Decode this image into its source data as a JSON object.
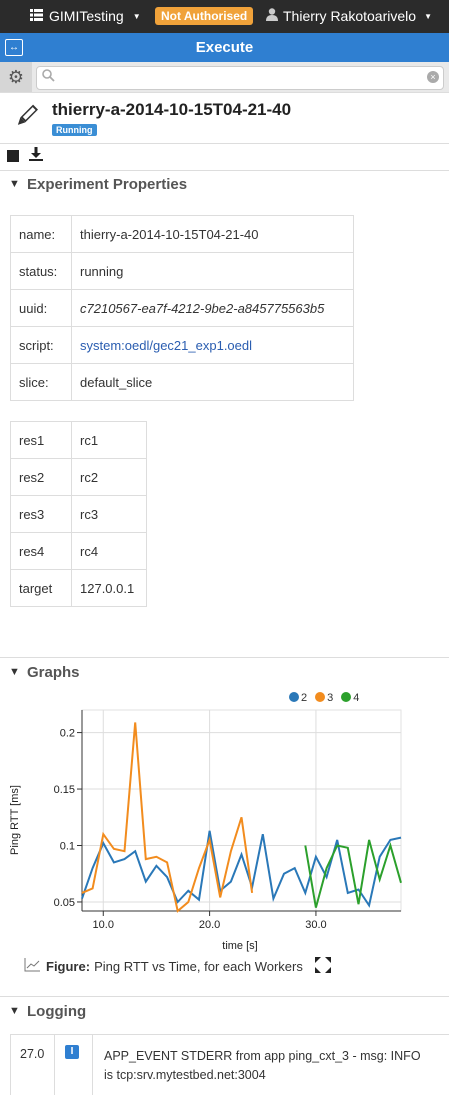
{
  "topbar": {
    "app_name": "GIMITesting",
    "auth_badge": "Not Authorised",
    "user_name": "Thierry Rakotoarivelo"
  },
  "execbar": {
    "title": "Execute"
  },
  "search": {
    "placeholder": ""
  },
  "experiment": {
    "title": "thierry-a-2014-10-15T04-21-40",
    "status_badge": "Running"
  },
  "sections": {
    "properties": "Experiment Properties",
    "graphs": "Graphs",
    "logging": "Logging"
  },
  "properties": [
    {
      "key": "name:",
      "value": "thierry-a-2014-10-15T04-21-40"
    },
    {
      "key": "status:",
      "value": "running"
    },
    {
      "key": "uuid:",
      "value": "c7210567-ea7f-4212-9be2-a845775563b5"
    },
    {
      "key": "script:",
      "value": "system:oedl/gec21_exp1.oedl"
    },
    {
      "key": "slice:",
      "value": "default_slice"
    }
  ],
  "resources": [
    {
      "key": "res1",
      "value": "rc1"
    },
    {
      "key": "res2",
      "value": "rc2"
    },
    {
      "key": "res3",
      "value": "rc3"
    },
    {
      "key": "res4",
      "value": "rc4"
    },
    {
      "key": "target",
      "value": "127.0.0.1"
    }
  ],
  "chart_data": {
    "type": "line",
    "title": "",
    "xlabel": "time [s]",
    "ylabel": "Ping RTT [ms]",
    "xlim": [
      8,
      38
    ],
    "ylim": [
      0.042,
      0.22
    ],
    "x_ticks": [
      10,
      20,
      30
    ],
    "x_tick_labels": [
      "10.0",
      "20.0",
      "30.0"
    ],
    "y_ticks": [
      0.05,
      0.1,
      0.15,
      0.2
    ],
    "y_tick_labels": [
      "0.05",
      "0.1",
      "0.15",
      "0.2"
    ],
    "legend_position": "top-right",
    "series": [
      {
        "name": "2",
        "color": "#2a78b8",
        "x": [
          8,
          9,
          10,
          11,
          12,
          13,
          14,
          15,
          16,
          17,
          18,
          19,
          20,
          21,
          22,
          23,
          24,
          25,
          26,
          27,
          28,
          29,
          30,
          31,
          32,
          33,
          34,
          35,
          36,
          37,
          38
        ],
        "y": [
          0.053,
          0.08,
          0.102,
          0.085,
          0.088,
          0.095,
          0.068,
          0.082,
          0.072,
          0.05,
          0.06,
          0.052,
          0.113,
          0.06,
          0.068,
          0.092,
          0.063,
          0.11,
          0.053,
          0.075,
          0.08,
          0.058,
          0.09,
          0.072,
          0.105,
          0.058,
          0.061,
          0.047,
          0.09,
          0.105,
          0.107
        ]
      },
      {
        "name": "3",
        "color": "#f28c1e",
        "x": [
          8,
          9,
          10,
          11,
          12,
          13,
          14,
          15,
          16,
          17,
          18,
          19,
          20,
          21,
          22,
          23,
          24
        ],
        "y": [
          0.058,
          0.062,
          0.11,
          0.097,
          0.095,
          0.209,
          0.088,
          0.09,
          0.085,
          0.027,
          0.05,
          0.08,
          0.105,
          0.054,
          0.095,
          0.125,
          0.058
        ]
      },
      {
        "name": "4",
        "color": "#2ca02c",
        "x": [
          29,
          30,
          31,
          32,
          33,
          34,
          35,
          36,
          37,
          38
        ],
        "y": [
          0.1,
          0.045,
          0.08,
          0.1,
          0.098,
          0.048,
          0.105,
          0.07,
          0.1,
          0.067
        ]
      }
    ]
  },
  "figure": {
    "label": "Figure:",
    "caption": "Ping RTT vs Time, for each Workers"
  },
  "log": [
    {
      "time": "27.0",
      "level": "I",
      "line1": "APP_EVENT STDERR from app ping_cxt_3 - msg: INFO",
      "line2": "is tcp:srv.mytestbed.net:3004"
    }
  ]
}
